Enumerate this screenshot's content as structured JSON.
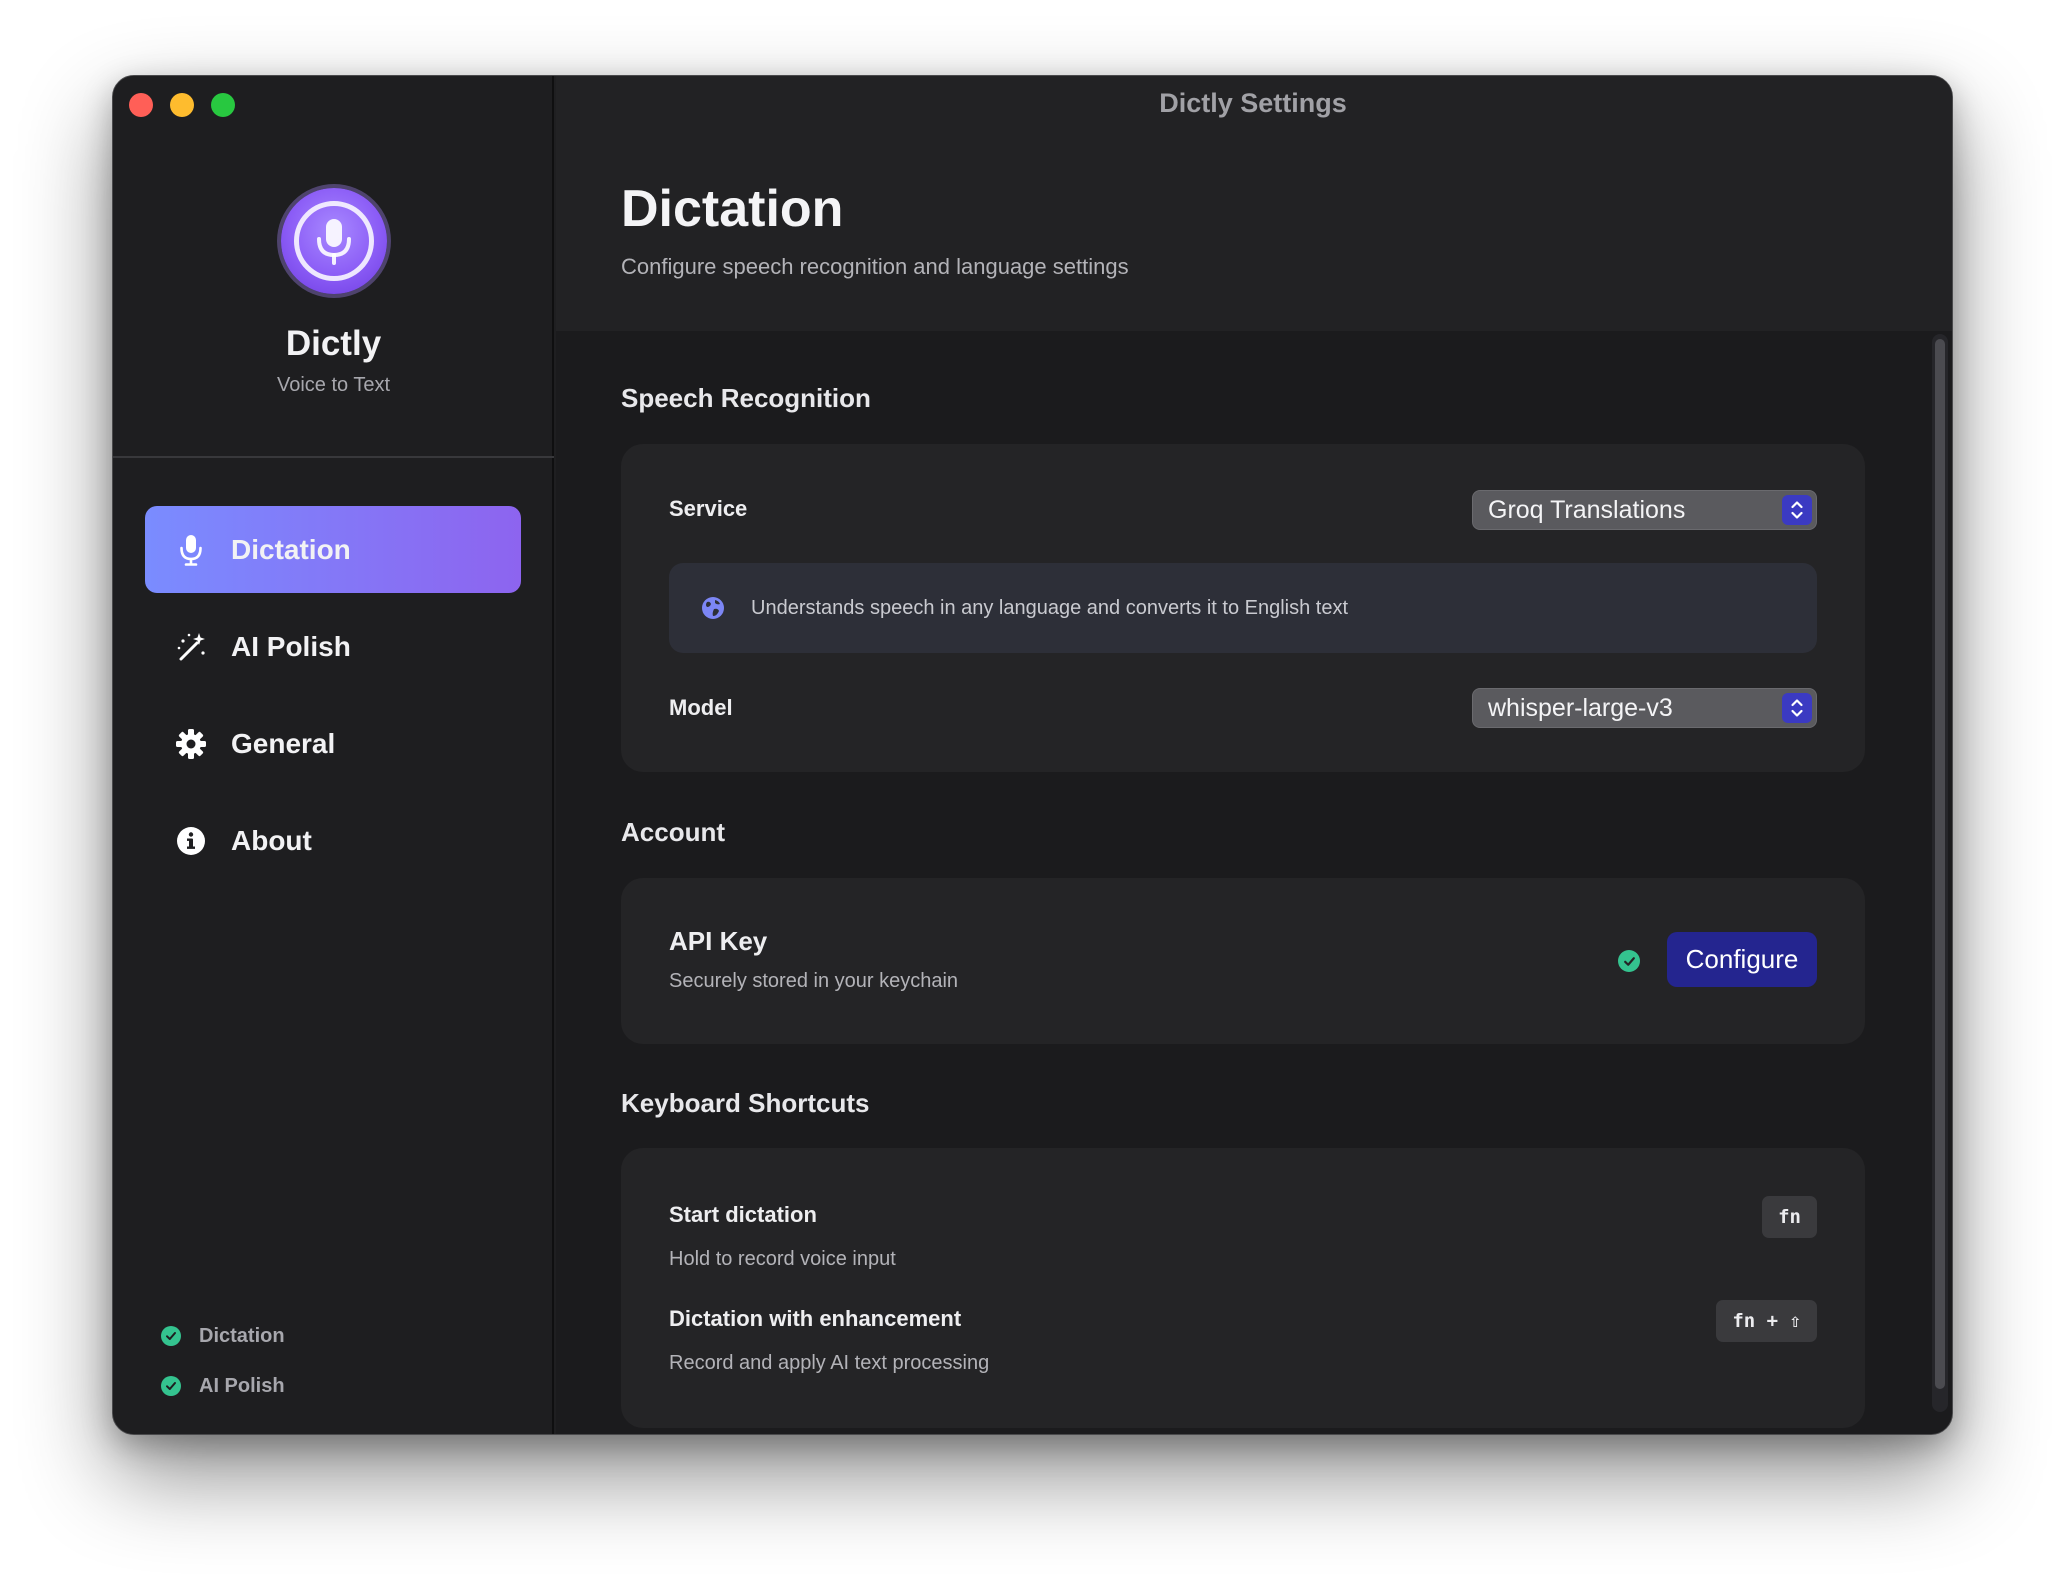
{
  "window": {
    "title": "Dictly Settings"
  },
  "sidebar": {
    "app_name": "Dictly",
    "app_subtitle": "Voice to Text",
    "app_icon": "microphone-icon",
    "items": [
      {
        "label": "Dictation",
        "icon": "microphone-icon",
        "active": true
      },
      {
        "label": "AI Polish",
        "icon": "magic-wand-icon",
        "active": false
      },
      {
        "label": "General",
        "icon": "gear-icon",
        "active": false
      },
      {
        "label": "About",
        "icon": "info-icon",
        "active": false
      }
    ],
    "status": [
      {
        "label": "Dictation",
        "state": "ok"
      },
      {
        "label": "AI Polish",
        "state": "ok"
      }
    ]
  },
  "page": {
    "title": "Dictation",
    "subtitle": "Configure speech recognition and language settings"
  },
  "speech_recognition": {
    "title": "Speech Recognition",
    "service_label": "Service",
    "service_value": "Groq Translations",
    "info_text": "Understands speech in any language and converts it to English text",
    "model_label": "Model",
    "model_value": "whisper-large-v3"
  },
  "account": {
    "title": "Account",
    "api_key_label": "API Key",
    "api_key_sub": "Securely stored in your keychain",
    "configure_label": "Configure",
    "status": "ok"
  },
  "shortcuts": {
    "title": "Keyboard Shortcuts",
    "items": [
      {
        "label": "Start dictation",
        "sub": "Hold to record voice input",
        "key": "fn"
      },
      {
        "label": "Dictation with enhancement",
        "sub": "Record and apply AI text processing",
        "key": "fn + ⇧"
      }
    ]
  },
  "colors": {
    "accent_gradient_start": "#7a8cff",
    "accent_gradient_end": "#8d64ef",
    "button": "#24258f",
    "success": "#34c38f"
  }
}
